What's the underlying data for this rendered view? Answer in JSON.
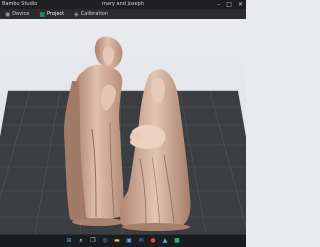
{
  "window": {
    "app_name": "Bambu Studio",
    "document_title": "mary and joseph",
    "controls": {
      "minimize": "–",
      "maximize": "□",
      "close": "✕"
    }
  },
  "tabs": [
    {
      "label": "Device",
      "icon": "wifi-icon",
      "glyph": "◉"
    },
    {
      "label": "Project",
      "icon": "folder-icon",
      "glyph": "▦"
    },
    {
      "label": "Calibration",
      "icon": "calibration-icon",
      "glyph": "◈"
    }
  ],
  "viewport": {
    "content": "3D model of two robed figures (standing man and seated woman holding a child) on a gridded build plate",
    "model_color": "#d8b5a2",
    "plate_color": "#3b3d40",
    "grid_color": "#55585c"
  },
  "taskbar": {
    "icons": [
      {
        "name": "start-icon",
        "glyph": "⊞",
        "color": "#3aa0ff"
      },
      {
        "name": "search-icon",
        "glyph": "⌕",
        "color": "#ffffff"
      },
      {
        "name": "task-view-icon",
        "glyph": "❐",
        "color": "#d0d0d0"
      },
      {
        "name": "edge-browser-icon",
        "glyph": "◎",
        "color": "#2fb6e8"
      },
      {
        "name": "file-explorer-icon",
        "glyph": "▬",
        "color": "#f2c23a"
      },
      {
        "name": "store-icon",
        "glyph": "▣",
        "color": "#5aa2ff"
      },
      {
        "name": "mail-icon",
        "glyph": "✉",
        "color": "#3f8cff"
      },
      {
        "name": "chrome-icon",
        "glyph": "●",
        "color": "#e94b3c"
      },
      {
        "name": "photos-icon",
        "glyph": "▲",
        "color": "#3ec3e0"
      },
      {
        "name": "bambu-studio-icon",
        "glyph": "■",
        "color": "#21b566"
      }
    ],
    "tray_lines": [
      "",
      ""
    ]
  }
}
